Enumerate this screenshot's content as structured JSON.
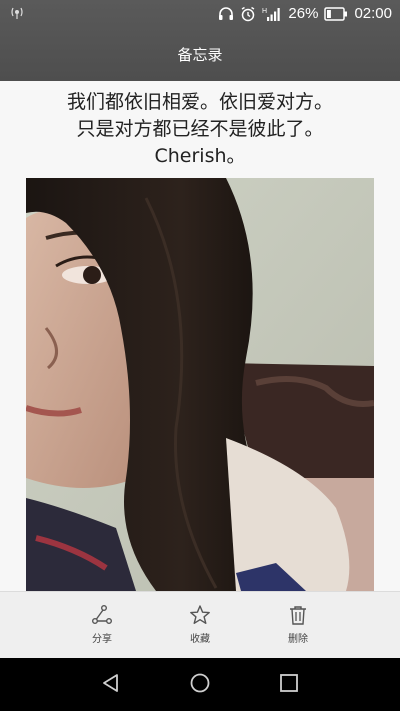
{
  "status_bar": {
    "battery_percent": "26%",
    "time": "02:00",
    "signal_label": "H",
    "battery_level": 0.26,
    "icons": [
      "usb-debug-icon",
      "headphones-icon",
      "alarm-icon",
      "signal-icon",
      "battery-icon"
    ]
  },
  "title": "备忘录",
  "note": {
    "lines": [
      "我们都依旧相爱。依旧爱对方。",
      "只是对方都已经不是彼此了。",
      "Cherish。"
    ]
  },
  "actions": [
    {
      "label": "分享",
      "icon": "share-icon"
    },
    {
      "label": "收藏",
      "icon": "star-icon"
    },
    {
      "label": "删除",
      "icon": "trash-icon"
    }
  ],
  "nav": {
    "icons": [
      "back-icon",
      "home-icon",
      "recents-icon"
    ]
  }
}
